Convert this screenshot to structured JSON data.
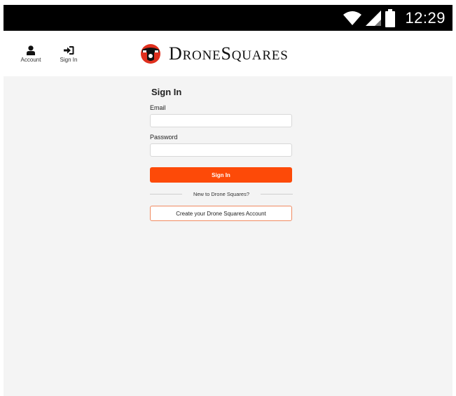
{
  "status_bar": {
    "wifi_icon": "wifi-icon",
    "signal_icon": "signal-icon",
    "battery_icon": "battery-icon",
    "time": "12:29"
  },
  "header": {
    "account_label": "Account",
    "account_icon": "user-icon",
    "signin_label": "Sign In",
    "signin_icon": "sign-in-icon",
    "logo_icon": "drone-logo-icon",
    "logo_text_1_cap": "D",
    "logo_text_1_rest": "RONE",
    "logo_text_2_cap": "S",
    "logo_text_2_rest": "QUARES"
  },
  "form": {
    "title": "Sign In",
    "email_label": "Email",
    "email_value": "",
    "password_label": "Password",
    "password_value": "",
    "signin_button": "Sign In",
    "divider_text": "New to Drone Squares?",
    "create_account_button": "Create your Drone Squares Account"
  },
  "colors": {
    "accent": "#fd4a08",
    "background": "#f4f4f4"
  }
}
